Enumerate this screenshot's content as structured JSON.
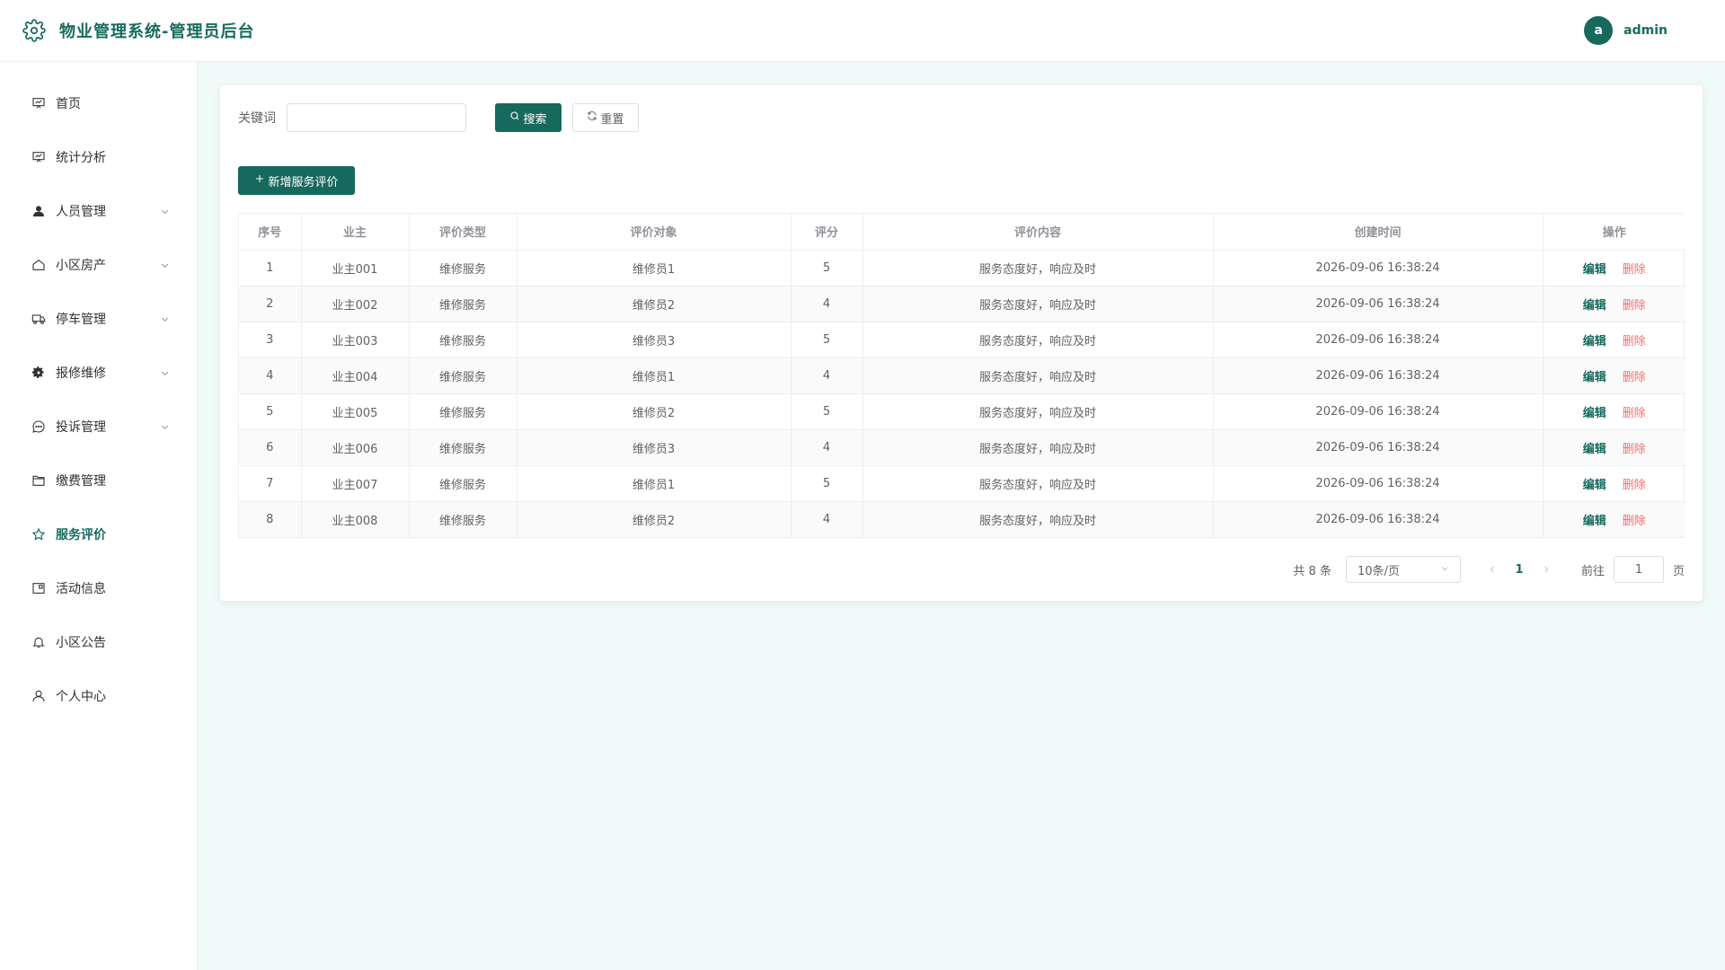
{
  "header": {
    "title": "物业管理系统-管理员后台",
    "avatar_letter": "a",
    "username": "admin",
    "accent_color": "#166b5f"
  },
  "sidebar": {
    "items": [
      {
        "label": "首页",
        "icon": "presentation-chart-icon",
        "has_children": false,
        "active": false
      },
      {
        "label": "统计分析",
        "icon": "presentation-chart-icon",
        "has_children": false,
        "active": false
      },
      {
        "label": "人员管理",
        "icon": "user-filled-icon",
        "has_children": true,
        "active": false
      },
      {
        "label": "小区房产",
        "icon": "house-icon",
        "has_children": true,
        "active": false
      },
      {
        "label": "停车管理",
        "icon": "van-icon",
        "has_children": true,
        "active": false
      },
      {
        "label": "报修维修",
        "icon": "gear-icon",
        "has_children": true,
        "active": false
      },
      {
        "label": "投诉管理",
        "icon": "chat-dots-icon",
        "has_children": true,
        "active": false
      },
      {
        "label": "缴费管理",
        "icon": "folder-icon",
        "has_children": false,
        "active": false
      },
      {
        "label": "服务评价",
        "icon": "star-icon",
        "has_children": false,
        "active": true
      },
      {
        "label": "活动信息",
        "icon": "postcard-icon",
        "has_children": false,
        "active": false
      },
      {
        "label": "小区公告",
        "icon": "bell-icon",
        "has_children": false,
        "active": false
      },
      {
        "label": "个人中心",
        "icon": "user-icon",
        "has_children": false,
        "active": false
      }
    ]
  },
  "search": {
    "label": "关键词",
    "value": "",
    "placeholder": "",
    "search_button": "搜索",
    "reset_button": "重置"
  },
  "toolbar": {
    "add_button": "新增服务评价"
  },
  "table": {
    "columns": [
      "序号",
      "业主",
      "评价类型",
      "评价对象",
      "评分",
      "评价内容",
      "创建时间",
      "操作"
    ],
    "rows": [
      {
        "index": "1",
        "owner": "业主001",
        "type": "维修服务",
        "target": "维修员1",
        "score": "5",
        "content": "服务态度好，响应及时",
        "created": "2026-09-06 16:38:24"
      },
      {
        "index": "2",
        "owner": "业主002",
        "type": "维修服务",
        "target": "维修员2",
        "score": "4",
        "content": "服务态度好，响应及时",
        "created": "2026-09-06 16:38:24"
      },
      {
        "index": "3",
        "owner": "业主003",
        "type": "维修服务",
        "target": "维修员3",
        "score": "5",
        "content": "服务态度好，响应及时",
        "created": "2026-09-06 16:38:24"
      },
      {
        "index": "4",
        "owner": "业主004",
        "type": "维修服务",
        "target": "维修员1",
        "score": "4",
        "content": "服务态度好，响应及时",
        "created": "2026-09-06 16:38:24"
      },
      {
        "index": "5",
        "owner": "业主005",
        "type": "维修服务",
        "target": "维修员2",
        "score": "5",
        "content": "服务态度好，响应及时",
        "created": "2026-09-06 16:38:24"
      },
      {
        "index": "6",
        "owner": "业主006",
        "type": "维修服务",
        "target": "维修员3",
        "score": "4",
        "content": "服务态度好，响应及时",
        "created": "2026-09-06 16:38:24"
      },
      {
        "index": "7",
        "owner": "业主007",
        "type": "维修服务",
        "target": "维修员1",
        "score": "5",
        "content": "服务态度好，响应及时",
        "created": "2026-09-06 16:38:24"
      },
      {
        "index": "8",
        "owner": "业主008",
        "type": "维修服务",
        "target": "维修员2",
        "score": "4",
        "content": "服务态度好，响应及时",
        "created": "2026-09-06 16:38:24"
      }
    ],
    "edit_label": "编辑",
    "delete_label": "删除",
    "delete_color": "#f56c6c"
  },
  "pagination": {
    "total_text": "共 8 条",
    "page_size": "10条/页",
    "current_page": "1",
    "goto_label": "前往",
    "goto_value": "1",
    "page_suffix": "页"
  }
}
